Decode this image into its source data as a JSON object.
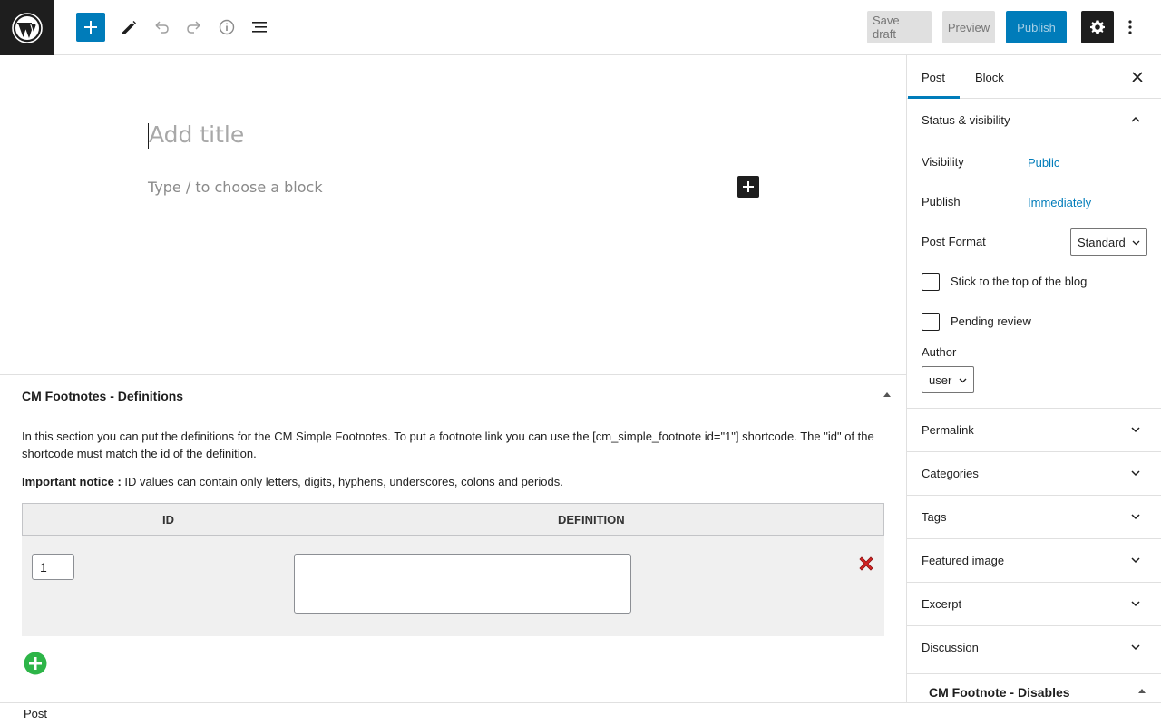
{
  "toolbar": {
    "save_draft": "Save draft",
    "preview": "Preview",
    "publish": "Publish",
    "icons": [
      "wordpress-logo-icon",
      "plus-icon",
      "pencil-icon",
      "undo-icon",
      "redo-icon",
      "info-icon",
      "list-view-icon",
      "gear-icon",
      "more-vertical-icon"
    ],
    "colors": {
      "accent": "#007cba",
      "dark": "#1e1e1e"
    }
  },
  "editor": {
    "title_placeholder": "Add title",
    "block_placeholder": "Type / to choose a block"
  },
  "metabox": {
    "title": "CM Footnotes - Definitions",
    "description": "In this section you can put the definitions for the CM Simple Footnotes. To put a footnote link you can use the [cm_simple_footnote id=\"1\"] shortcode. The \"id\" of the shortcode must match the id of the definition.",
    "notice_label": "Important notice :",
    "notice_text": " ID values can contain only letters, digits, hyphens, underscores, colons and periods.",
    "columns": [
      "ID",
      "DEFINITION"
    ],
    "rows": [
      {
        "id": "1",
        "definition": ""
      }
    ]
  },
  "statusbar": {
    "breadcrumb": "Post"
  },
  "sidebar": {
    "tabs": [
      "Post",
      "Block"
    ],
    "active_tab": "Post",
    "status_panel": {
      "title": "Status & visibility",
      "visibility_label": "Visibility",
      "visibility_value": "Public",
      "publish_label": "Publish",
      "publish_value": "Immediately",
      "format_label": "Post Format",
      "format_value": "Standard",
      "sticky_label": "Stick to the top of the blog",
      "pending_label": "Pending review",
      "author_label": "Author",
      "author_value": "user"
    },
    "panels": [
      "Permalink",
      "Categories",
      "Tags",
      "Featured image",
      "Excerpt",
      "Discussion"
    ],
    "cm_panel": "CM Footnote - Disables"
  }
}
